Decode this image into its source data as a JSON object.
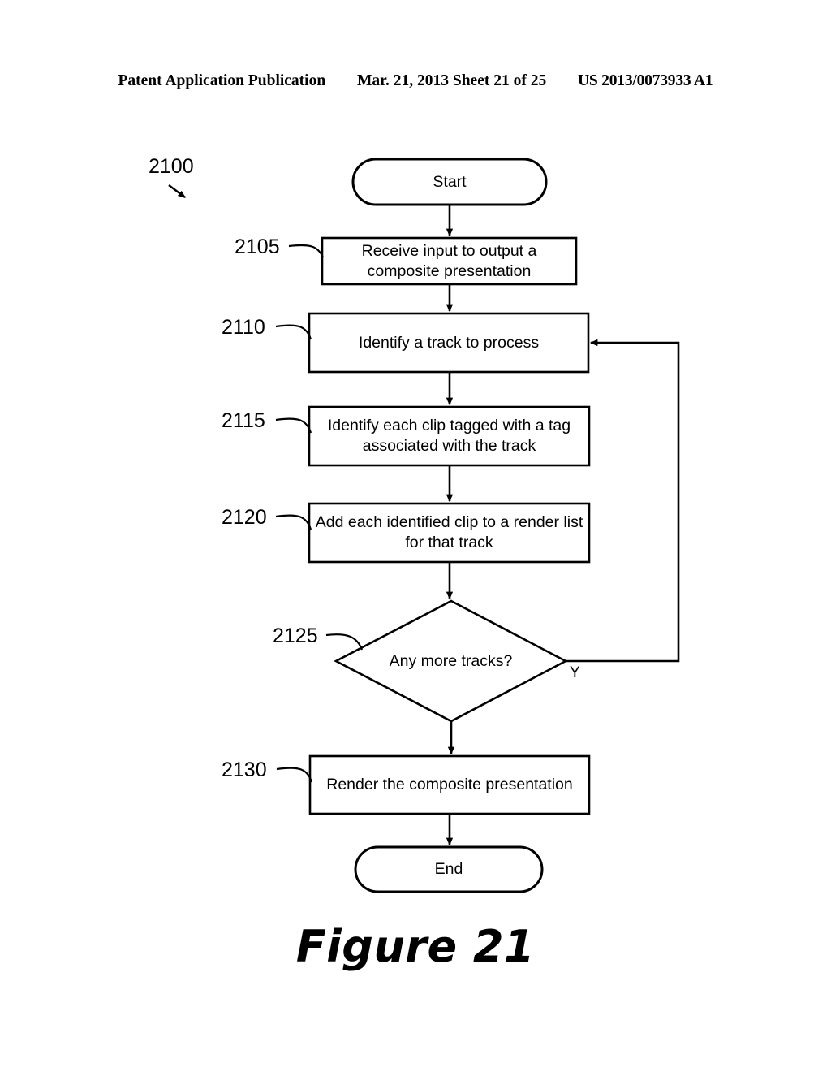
{
  "header": {
    "publication": "Patent Application Publication",
    "date_sheet": "Mar. 21, 2013  Sheet 21 of 25",
    "patent_number": "US 2013/0073933 A1"
  },
  "figure": {
    "caption": "Figure 21",
    "process_ref": "2100"
  },
  "flow": {
    "start_label": "Start",
    "end_label": "End",
    "branch_yes": "Y",
    "nodes": [
      {
        "ref": "2105",
        "text": "Receive input to output a\ncomposite presentation",
        "shape": "process"
      },
      {
        "ref": "2110",
        "text": "Identify a track to process",
        "shape": "process"
      },
      {
        "ref": "2115",
        "text": "Identify each clip tagged with a tag\nassociated with the track",
        "shape": "process"
      },
      {
        "ref": "2120",
        "text": "Add each identified clip to a render list\nfor that track",
        "shape": "process"
      },
      {
        "ref": "2125",
        "text": "Any more tracks?",
        "shape": "decision"
      },
      {
        "ref": "2130",
        "text": "Render the composite presentation",
        "shape": "process"
      }
    ]
  },
  "colors": {
    "ink": "#000000",
    "paper": "#ffffff"
  }
}
